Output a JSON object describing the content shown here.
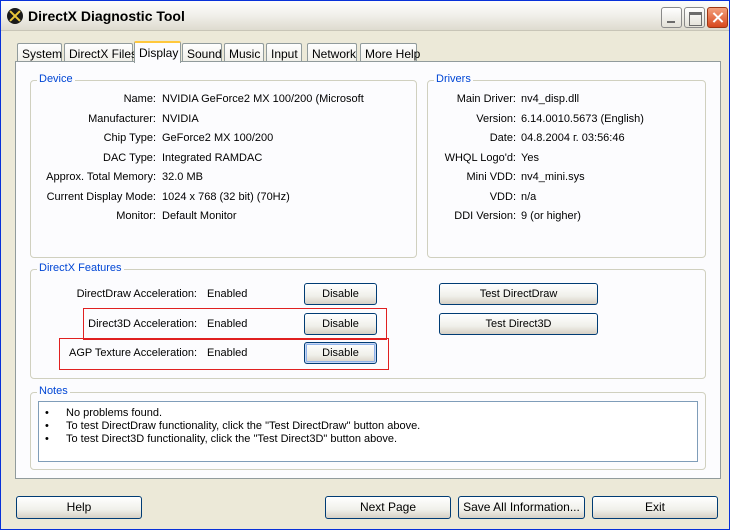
{
  "window": {
    "title": "DirectX Diagnostic Tool"
  },
  "tabs": [
    {
      "label": "System"
    },
    {
      "label": "DirectX Files"
    },
    {
      "label": "Display"
    },
    {
      "label": "Sound"
    },
    {
      "label": "Music"
    },
    {
      "label": "Input"
    },
    {
      "label": "Network"
    },
    {
      "label": "More Help"
    }
  ],
  "active_tab": "Display",
  "device": {
    "title": "Device",
    "rows": [
      {
        "label": "Name:",
        "value": "NVIDIA GeForce2 MX 100/200 (Microsoft"
      },
      {
        "label": "Manufacturer:",
        "value": "NVIDIA"
      },
      {
        "label": "Chip Type:",
        "value": "GeForce2 MX 100/200"
      },
      {
        "label": "DAC Type:",
        "value": "Integrated RAMDAC"
      },
      {
        "label": "Approx. Total Memory:",
        "value": "32.0 MB"
      },
      {
        "label": "Current Display Mode:",
        "value": "1024 x 768 (32 bit) (70Hz)"
      },
      {
        "label": "Monitor:",
        "value": "Default Monitor"
      }
    ]
  },
  "drivers": {
    "title": "Drivers",
    "rows": [
      {
        "label": "Main Driver:",
        "value": "nv4_disp.dll"
      },
      {
        "label": "Version:",
        "value": "6.14.0010.5673 (English)"
      },
      {
        "label": "Date:",
        "value": "04.8.2004 г. 03:56:46"
      },
      {
        "label": "WHQL Logo'd:",
        "value": "Yes"
      },
      {
        "label": "Mini VDD:",
        "value": "nv4_mini.sys"
      },
      {
        "label": "VDD:",
        "value": "n/a"
      },
      {
        "label": "DDI Version:",
        "value": "9 (or higher)"
      }
    ]
  },
  "features": {
    "title": "DirectX Features",
    "rows": [
      {
        "label": "DirectDraw Acceleration:",
        "value": "Enabled",
        "button": "Disable"
      },
      {
        "label": "Direct3D Acceleration:",
        "value": "Enabled",
        "button": "Disable"
      },
      {
        "label": "AGP Texture Acceleration:",
        "value": "Enabled",
        "button": "Disable"
      }
    ],
    "test_directdraw": "Test DirectDraw",
    "test_direct3d": "Test Direct3D"
  },
  "notes": {
    "title": "Notes",
    "items": [
      {
        "bullet": "•",
        "text": "No problems found."
      },
      {
        "bullet": "•",
        "text": "To test DirectDraw functionality, click the \"Test DirectDraw\" button above."
      },
      {
        "bullet": "•",
        "text": "To test Direct3D functionality, click the \"Test Direct3D\" button above."
      }
    ]
  },
  "bottom_buttons": {
    "help": "Help",
    "next_page": "Next Page",
    "save_all": "Save All Information...",
    "exit": "Exit"
  },
  "colors": {
    "group_title": "#0046d5",
    "highlight_box": "#e02020",
    "active_tab_accent": "#ffc83c"
  }
}
